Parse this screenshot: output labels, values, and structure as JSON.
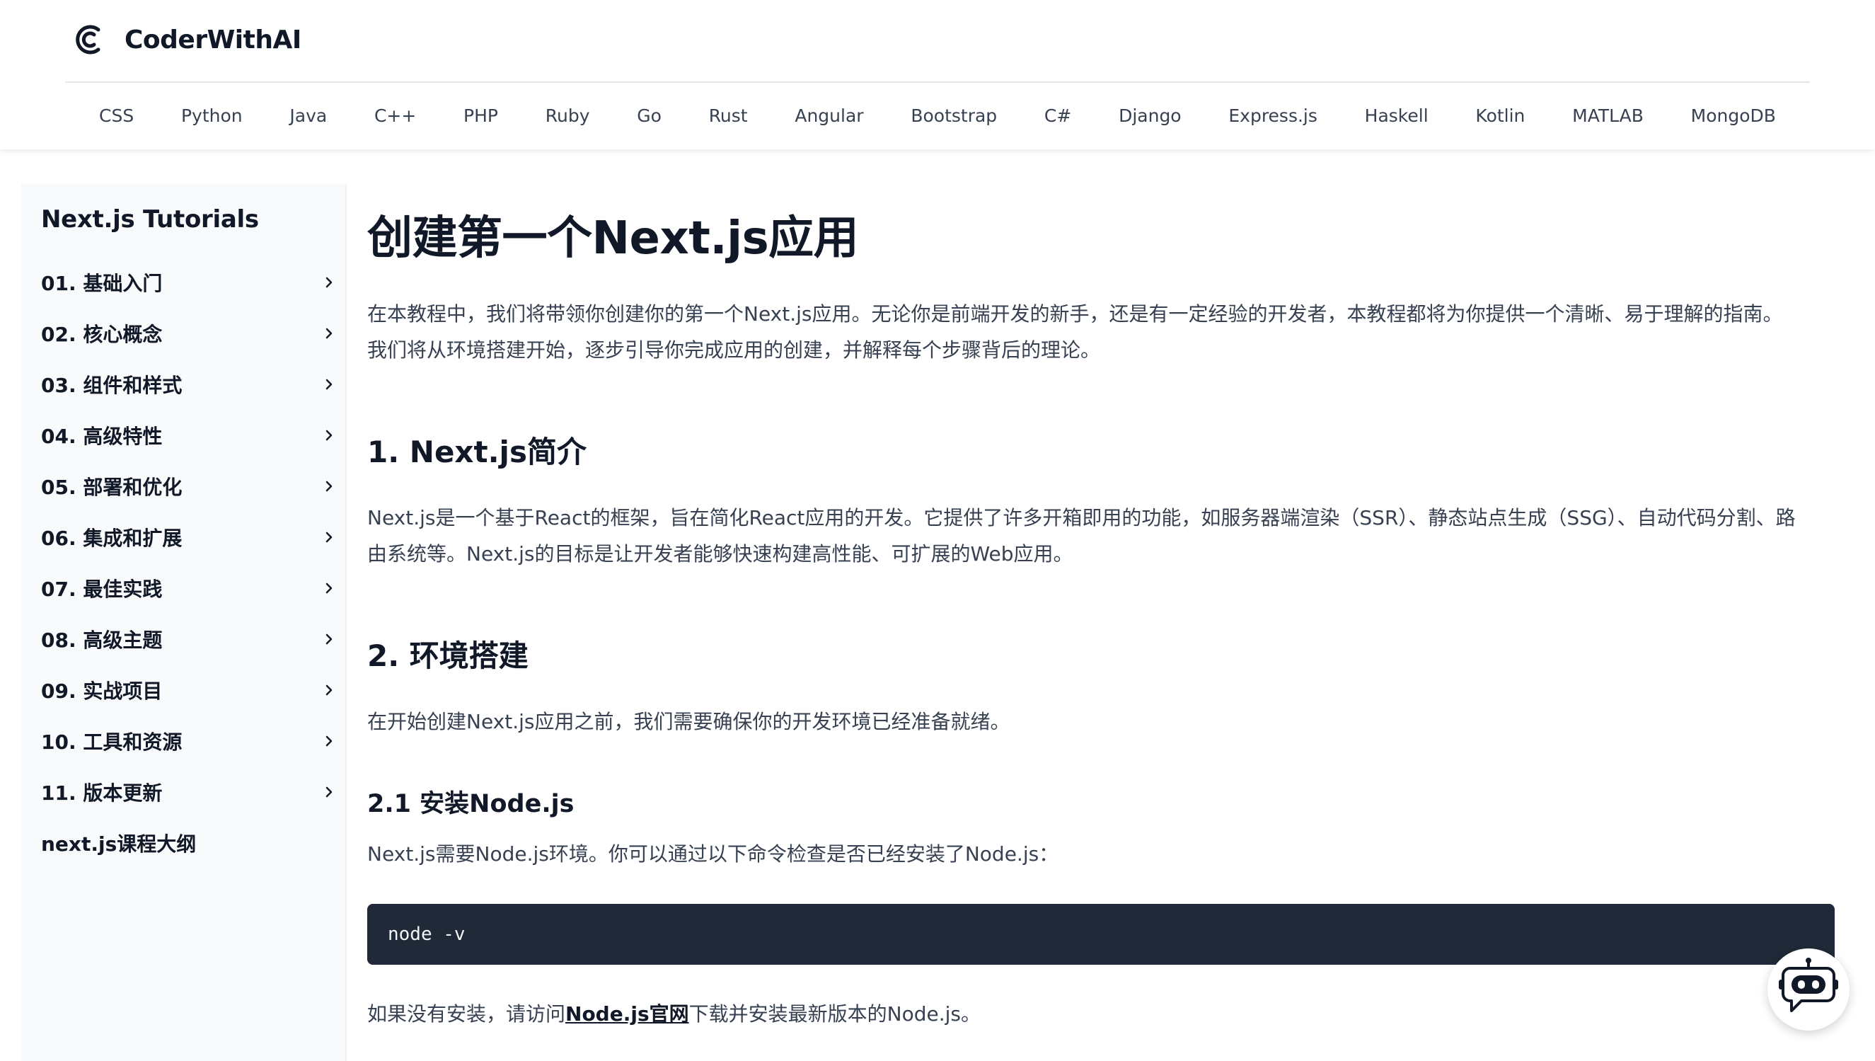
{
  "brand": {
    "name": "CoderWithAI"
  },
  "nav": {
    "items": [
      "CSS",
      "Python",
      "Java",
      "C++",
      "PHP",
      "Ruby",
      "Go",
      "Rust",
      "Angular",
      "Bootstrap",
      "C#",
      "Django",
      "Express.js",
      "Haskell",
      "Kotlin",
      "MATLAB",
      "MongoDB"
    ]
  },
  "sidebar": {
    "title": "Next.js Tutorials",
    "items": [
      {
        "label": "01. 基础入门"
      },
      {
        "label": "02. 核心概念"
      },
      {
        "label": "03. 组件和样式"
      },
      {
        "label": "04. 高级特性"
      },
      {
        "label": "05. 部署和优化"
      },
      {
        "label": "06. 集成和扩展"
      },
      {
        "label": "07. 最佳实践"
      },
      {
        "label": "08. 高级主题"
      },
      {
        "label": "09. 实战项目"
      },
      {
        "label": "10. 工具和资源"
      },
      {
        "label": "11. 版本更新"
      }
    ],
    "outline_label": "next.js课程大纲"
  },
  "article": {
    "title": "创建第一个Next.js应用",
    "intro_line1": "在本教程中，我们将带领你创建你的第一个Next.js应用。无论你是前端开发的新手，还是有一定经验的开发者，本教程都将为你提供一个清晰、易于理解的指南。",
    "intro_line2": "我们将从环境搭建开始，逐步引导你完成应用的创建，并解释每个步骤背后的理论。",
    "s1_heading": "1. Next.js简介",
    "s1_line1": "Next.js是一个基于React的框架，旨在简化React应用的开发。它提供了许多开箱即用的功能，如服务器端渲染（SSR）、静态站点生成（SSG）、自动代码分割、路",
    "s1_line2": "由系统等。Next.js的目标是让开发者能够快速构建高性能、可扩展的Web应用。",
    "s2_heading": "2. 环境搭建",
    "s2_text": "在开始创建Next.js应用之前，我们需要确保你的开发环境已经准备就绪。",
    "s21_heading": "2.1 安装Node.js",
    "s21_text": "Next.js需要Node.js环境。你可以通过以下命令检查是否已经安装了Node.js：",
    "code": "node -v",
    "install_prefix": "如果没有安装，请访问",
    "install_link": "Node.js官网",
    "install_suffix": "下载并安装最新版本的Node.js。"
  },
  "colors": {
    "code_bg": "#1f2937",
    "sidebar_bg": "#f9fafb",
    "text_primary": "#111827",
    "text_body": "#374151"
  }
}
